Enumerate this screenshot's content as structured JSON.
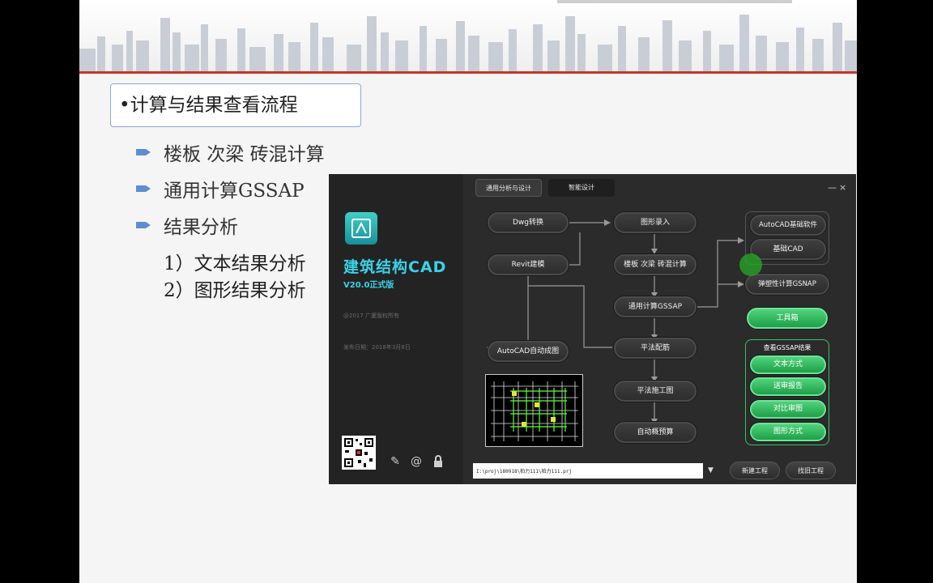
{
  "slide": {
    "title": "•计算与结果查看流程",
    "bullets": [
      "楼板  次梁  砖混计算",
      "通用计算GSSAP",
      "结果分析"
    ],
    "sub_items": [
      "1）文本结果分析",
      "2）图形结果分析"
    ]
  },
  "app": {
    "tabs": [
      "通用分析与设计",
      "智能设计"
    ],
    "window_controls": {
      "minimize": "—",
      "close": "×"
    },
    "brand": "建筑结构CAD",
    "version": "V20.0正式版",
    "copyright": "@2017 广厦版权所有",
    "release_date": "发布日期：2018年3月8日",
    "flow": {
      "dwg": "Dwg转换",
      "revit": "Revit建模",
      "autocad_draw": "AutoCAD自动成图",
      "graph_input": "图形录入",
      "floor_calc": "楼板 次梁 砖混计算",
      "gssap": "通用计算GSSAP",
      "rebar": "平法配筋",
      "construction": "平法施工图",
      "budget": "自动概预算"
    },
    "right": {
      "autocad_base": "AutoCAD基础软件",
      "base_cad": "基础CAD",
      "gsnap": "弹塑性计算GSNAP",
      "toolbox": "工具箱",
      "results_title": "查看GSSAP结果",
      "results": [
        "文本方式",
        "送审报告",
        "对比审图",
        "图形方式"
      ]
    },
    "path_value": "I:\\proj\\180918\\柏力111\\柏力111.prj",
    "new_project": "新建工程",
    "open_project": "找旧工程",
    "icons": [
      "edit-icon",
      "at-icon",
      "lock-icon"
    ]
  },
  "colors": {
    "accent_cyan": "#3ad2e6",
    "green": "#2fb85a",
    "red_line": "#c0392b"
  }
}
